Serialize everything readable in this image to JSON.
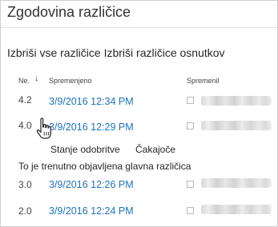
{
  "dialog": {
    "title": "Zgodovina različice"
  },
  "actions": {
    "delete_all": "Izbriši vse različice",
    "delete_drafts": "Izbriši različice osnutkov"
  },
  "columns": {
    "no": "Ne.",
    "modified": "Spremenjeno",
    "modified_by": "Spremenil"
  },
  "versions": [
    {
      "number": "4.2",
      "date": "3/9/2016 12:34 PM"
    },
    {
      "number": "4.0",
      "date": "3/9/2016 12:29 PM"
    },
    {
      "number": "3.0",
      "date": "3/9/2016 12:26 PM"
    },
    {
      "number": "2.0",
      "date": "3/9/2016 12:24 PM"
    }
  ],
  "version_details": {
    "status_label": "Stanje odobritve",
    "status_value": "Čakajoče",
    "published_note": "To je trenutno objavljena glavna različica"
  },
  "icons": {
    "sort": "sort-descending-icon",
    "pointer": "hand-pointer-icon"
  },
  "colors": {
    "link": "#1e73be",
    "text": "#333333"
  }
}
